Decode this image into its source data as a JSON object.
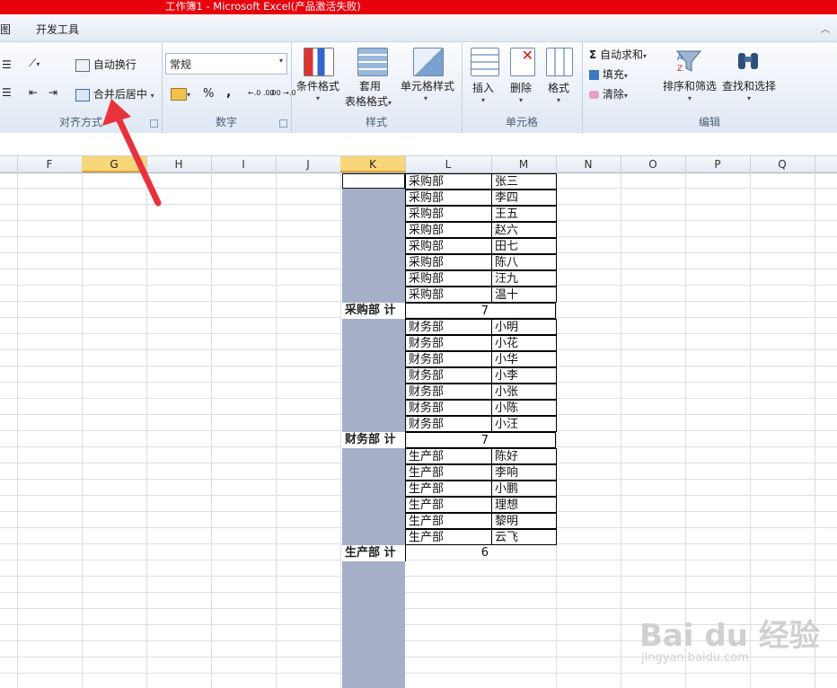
{
  "window": {
    "title": "工作簿1  -  Microsoft Excel(产品激活失败)"
  },
  "menu": {
    "items": [
      "图",
      "开发工具"
    ],
    "help": "︿"
  },
  "ribbon": {
    "alignment": {
      "wrap": "自动换行",
      "merge": "合并后居中",
      "label": "对齐方式"
    },
    "number": {
      "format": "常规",
      "percent": "%",
      "comma": ",",
      "inc_dec": "←.0 .00",
      "dec_dec": ".00 →.0",
      "label": "数字"
    },
    "styles": {
      "cond": "条件格式",
      "table1": "套用",
      "table2": "表格格式",
      "cell_style": "单元格样式",
      "label": "样式"
    },
    "cells": {
      "insert": "插入",
      "delete": "删除",
      "format": "格式",
      "label": "单元格"
    },
    "editing": {
      "autosum": "自动求和",
      "fill": "填充",
      "clear": "清除",
      "sort": "排序和筛选",
      "find": "查找和选择",
      "label": "编辑"
    }
  },
  "columns": [
    "F",
    "G",
    "H",
    "I",
    "J",
    "K",
    "L",
    "M",
    "N",
    "O",
    "P",
    "Q"
  ],
  "rows": [
    {
      "dept": "采购部",
      "name": "张三"
    },
    {
      "dept": "采购部",
      "name": "李四"
    },
    {
      "dept": "采购部",
      "name": "王五"
    },
    {
      "dept": "采购部",
      "name": "赵六"
    },
    {
      "dept": "采购部",
      "name": "田七"
    },
    {
      "dept": "采购部",
      "name": "陈八"
    },
    {
      "dept": "采购部",
      "name": "汪九"
    },
    {
      "dept": "采购部",
      "name": "温十"
    },
    {
      "summary": "采购部 计",
      "count": "7"
    },
    {
      "dept": "财务部",
      "name": "小明"
    },
    {
      "dept": "财务部",
      "name": "小花"
    },
    {
      "dept": "财务部",
      "name": "小华"
    },
    {
      "dept": "财务部",
      "name": "小李"
    },
    {
      "dept": "财务部",
      "name": "小张"
    },
    {
      "dept": "财务部",
      "name": "小陈"
    },
    {
      "dept": "财务部",
      "name": "小汪"
    },
    {
      "summary": "财务部 计",
      "count": "7"
    },
    {
      "dept": "生产部",
      "name": "陈好"
    },
    {
      "dept": "生产部",
      "name": "李响"
    },
    {
      "dept": "生产部",
      "name": "小鹏"
    },
    {
      "dept": "生产部",
      "name": "理想"
    },
    {
      "dept": "生产部",
      "name": "黎明"
    },
    {
      "dept": "生产部",
      "name": "云飞"
    },
    {
      "summary": "生产部 计",
      "count": "6"
    }
  ],
  "watermark": {
    "main": "Bai du 经验",
    "sub": "jingyan.baidu.com"
  },
  "colors": {
    "title_bar": "#e8000c",
    "selected_column": "#a6afc8",
    "header_selected": "#f8d67a",
    "arrow": "#e8323c"
  }
}
